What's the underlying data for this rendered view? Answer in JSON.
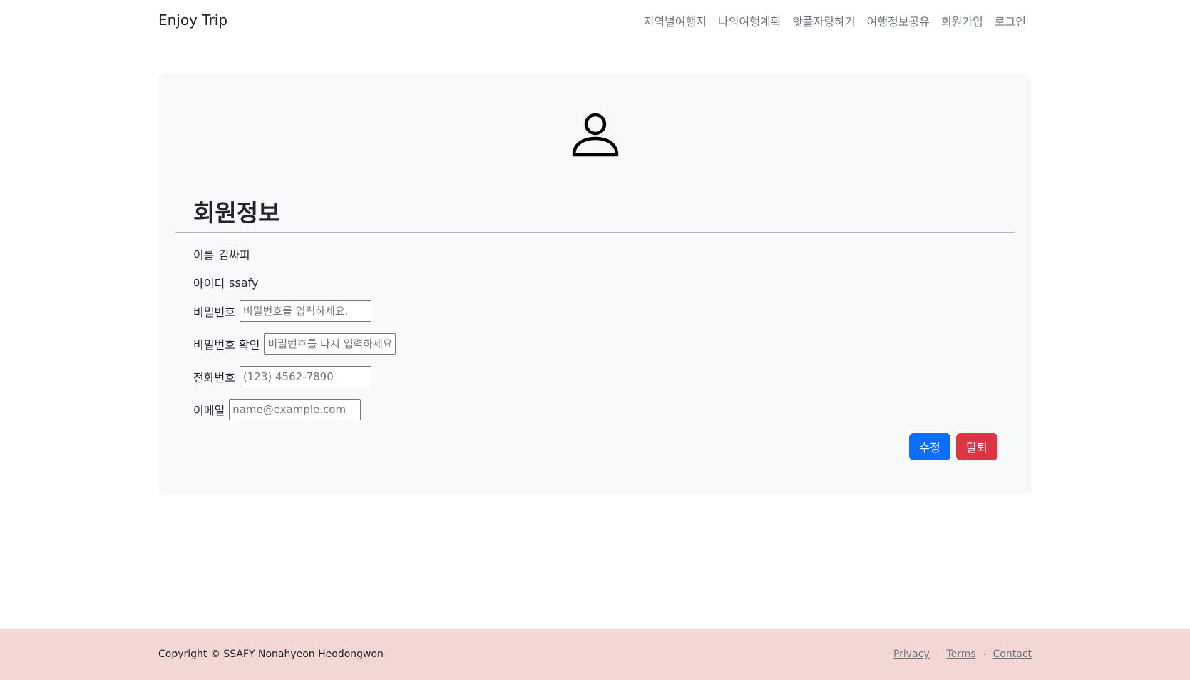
{
  "navbar": {
    "brand": "Enjoy Trip",
    "links": [
      "지역별여행지",
      "나의여행계획",
      "핫플자랑하기",
      "여행정보공유",
      "회원가입",
      "로그인"
    ]
  },
  "profile": {
    "icon": "person-icon",
    "title": "회원정보",
    "name_label": "이름",
    "name_value": "김싸피",
    "id_label": "아이디",
    "id_value": "ssafy",
    "password_label": "비밀번호",
    "password_placeholder": "비밀번호를 입력하세요.",
    "password_confirm_label": "비밀번호 확인",
    "password_confirm_placeholder": "비밀번호를 다시 입력하세요.",
    "phone_label": "전화번호",
    "phone_placeholder": "(123) 4562-7890",
    "email_label": "이메일",
    "email_placeholder": "name@example.com",
    "edit_button": "수정",
    "withdraw_button": "탈퇴"
  },
  "footer": {
    "copyright": "Copyright © SSAFY Nonahyeon Heodongwon",
    "links": [
      "Privacy",
      "Terms",
      "Contact"
    ],
    "separator": "·"
  },
  "colors": {
    "primary": "#0d6efd",
    "danger": "#dc3545",
    "card_bg": "#f8f9fa",
    "footer_bg": "#f2d7d5"
  }
}
